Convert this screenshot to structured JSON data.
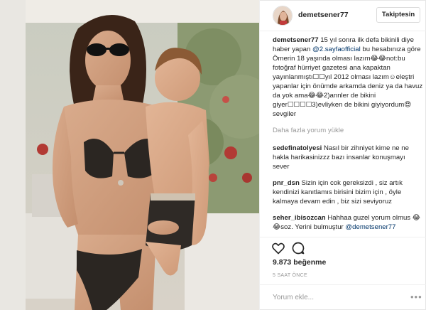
{
  "post": {
    "username": "demetsener77",
    "follow_label": "Takiptesin"
  },
  "caption": {
    "user": "demetsener77",
    "text_a": " 15 yıl sonra ilk defa bikinili diye haber yapan ",
    "mention": "@2.sayfaofficial",
    "text_b": " bu hesabınıza göre Ömerin 18 yaşında olması lazım😂😂not:bu fotoğraf hürriyet gazetesi ana kapaktan yayınlanmıştı☐☐yıl 2012 olması lazım☺eleştri yapanlar için önümde arkamda deniz ya da havuz da yok ama😂😂2)annler de bikini giyer☐☐☐☐3)evliyken de bikini giyiyordum😍sevgiler"
  },
  "more_comments_label": "Daha fazla yorum yükle",
  "comments": [
    {
      "user": "sedefinatolyesi",
      "text": " Nasıl bir zihniyet kime ne ne hakla harikasinizzz bazı insanlar konuşmayı sever"
    },
    {
      "user": "pnr_dsn",
      "text": " Sizin için cok gereksizdi , siz artık kendinizi kanıtlamıs birisini bizim için , öyle kalmaya devam edin , biz sizi seviyoruz"
    },
    {
      "user": "seher_ibisozcan",
      "text": " Hahhaa guzel yorum olmus 😂😂soz. Yerini bulmuştur ",
      "mention": "@demetsener77"
    }
  ],
  "likes_label": "9.873 beğenme",
  "time_label": "5 SAAT ÖNCE",
  "add_comment_placeholder": "Yorum ekle...",
  "more_options_label": "•••",
  "icons": [
    "heart-icon",
    "comment-icon",
    "more-options-icon"
  ],
  "colors": {
    "link": "#003569",
    "muted": "#999999",
    "border": "#efefef"
  }
}
